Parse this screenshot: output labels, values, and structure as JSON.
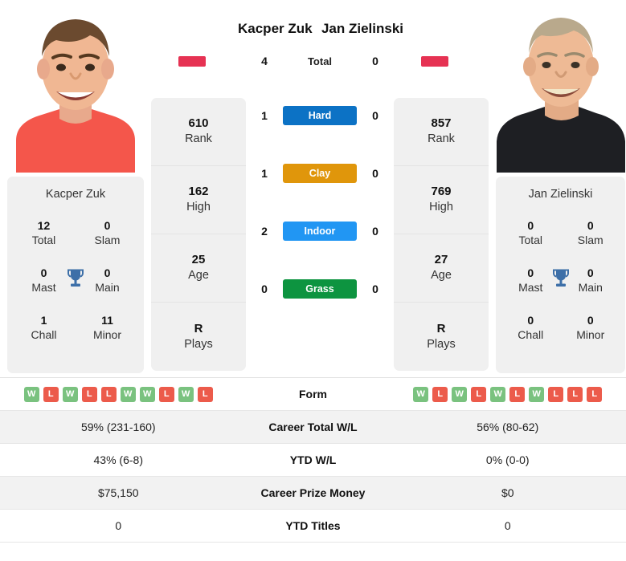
{
  "players": {
    "left": {
      "name": "Kacper Zuk",
      "flag_color": "#e63253",
      "card_name": "Kacper Zuk",
      "titles": {
        "total": {
          "value": "12",
          "label": "Total"
        },
        "slam": {
          "value": "0",
          "label": "Slam"
        },
        "mast": {
          "value": "0",
          "label": "Mast"
        },
        "main": {
          "value": "0",
          "label": "Main"
        },
        "chall": {
          "value": "1",
          "label": "Chall"
        },
        "minor": {
          "value": "11",
          "label": "Minor"
        }
      },
      "stats": [
        {
          "value": "610",
          "label": "Rank"
        },
        {
          "value": "162",
          "label": "High"
        },
        {
          "value": "25",
          "label": "Age"
        },
        {
          "value": "R",
          "label": "Plays"
        }
      ],
      "form": [
        "W",
        "L",
        "W",
        "L",
        "L",
        "W",
        "W",
        "L",
        "W",
        "L"
      ]
    },
    "right": {
      "name": "Jan Zielinski",
      "flag_color": "#e63253",
      "card_name": "Jan Zielinski",
      "titles": {
        "total": {
          "value": "0",
          "label": "Total"
        },
        "slam": {
          "value": "0",
          "label": "Slam"
        },
        "mast": {
          "value": "0",
          "label": "Mast"
        },
        "main": {
          "value": "0",
          "label": "Main"
        },
        "chall": {
          "value": "0",
          "label": "Chall"
        },
        "minor": {
          "value": "0",
          "label": "Minor"
        }
      },
      "stats": [
        {
          "value": "857",
          "label": "Rank"
        },
        {
          "value": "769",
          "label": "High"
        },
        {
          "value": "27",
          "label": "Age"
        },
        {
          "value": "R",
          "label": "Plays"
        }
      ],
      "form": [
        "W",
        "L",
        "W",
        "L",
        "W",
        "L",
        "W",
        "L",
        "L",
        "L"
      ]
    }
  },
  "head_to_head": {
    "total": {
      "label": "Total",
      "left": "4",
      "right": "0"
    },
    "surfaces": [
      {
        "label": "Hard",
        "color": "#0c72c5",
        "left": "1",
        "right": "0"
      },
      {
        "label": "Clay",
        "color": "#e0960b",
        "left": "1",
        "right": "0"
      },
      {
        "label": "Indoor",
        "color": "#2196f3",
        "left": "2",
        "right": "0"
      },
      {
        "label": "Grass",
        "color": "#0d9440",
        "left": "0",
        "right": "0"
      }
    ]
  },
  "comparison_rows": [
    {
      "label": "Form",
      "left": "",
      "right": ""
    },
    {
      "label": "Career Total W/L",
      "left": "59% (231-160)",
      "right": "56% (80-62)"
    },
    {
      "label": "YTD W/L",
      "left": "43% (6-8)",
      "right": "0% (0-0)"
    },
    {
      "label": "Career Prize Money",
      "left": "$75,150",
      "right": "$0"
    },
    {
      "label": "YTD Titles",
      "left": "0",
      "right": "0"
    }
  ]
}
